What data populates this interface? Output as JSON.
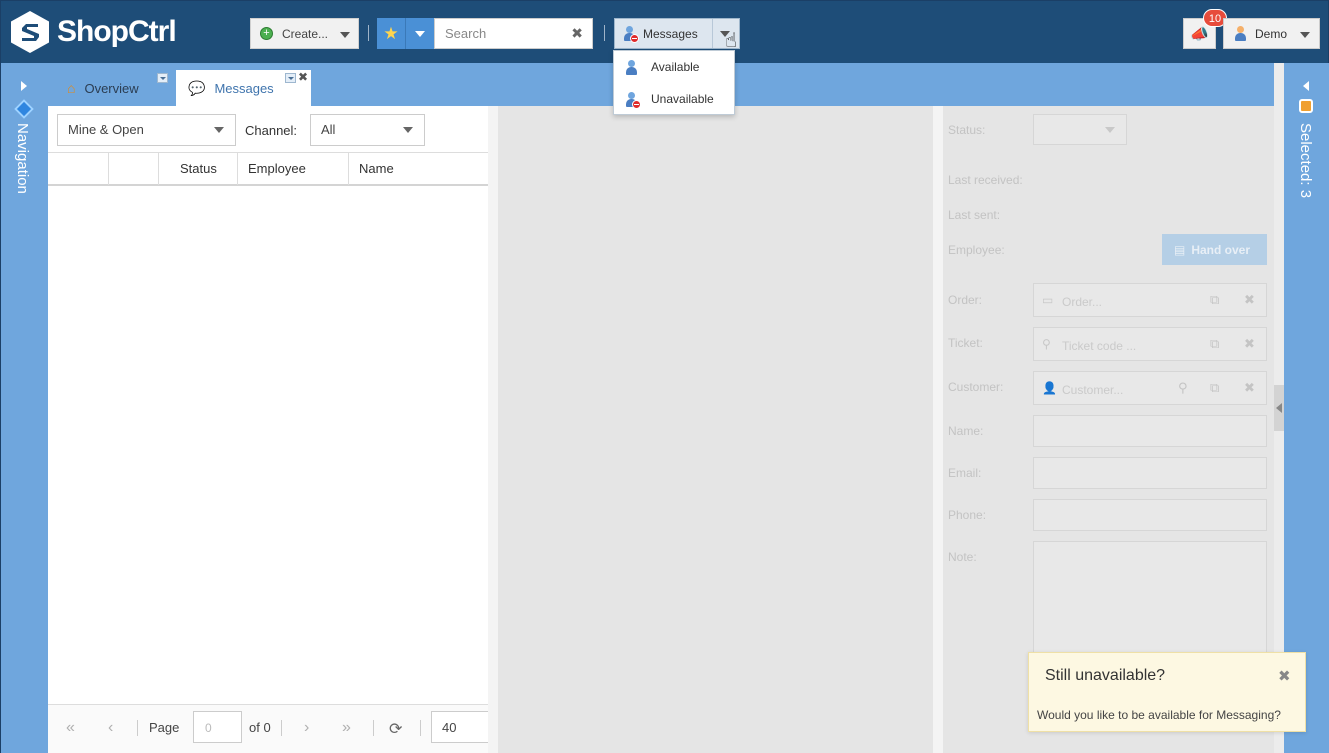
{
  "app": {
    "name": "ShopCtrl"
  },
  "header": {
    "create_label": "Create...",
    "search_placeholder": "Search",
    "messages_label": "Messages",
    "notification_count": "10",
    "user_label": "Demo"
  },
  "status_menu": {
    "items": [
      {
        "label": "Available",
        "icon": "person-available-icon"
      },
      {
        "label": "Unavailable",
        "icon": "person-unavailable-icon"
      }
    ]
  },
  "rails": {
    "left_label": "Navigation",
    "right_label": "Selected: 3"
  },
  "tabs": [
    {
      "label": "Overview",
      "icon": "home-icon"
    },
    {
      "label": "Messages",
      "icon": "speech-bubbles-icon",
      "active": true
    }
  ],
  "list": {
    "filter_value": "Mine & Open",
    "channel_label": "Channel:",
    "channel_value": "All",
    "columns": [
      "",
      "",
      "Status",
      "Employee",
      "Name"
    ],
    "rows": []
  },
  "pager": {
    "page_label": "Page",
    "page_value": "0",
    "of_label": "of 0",
    "page_size": "40"
  },
  "detail": {
    "status_label": "Status:",
    "last_received_label": "Last received:",
    "last_sent_label": "Last sent:",
    "employee_label": "Employee:",
    "handover_label": "Hand over",
    "order_label": "Order:",
    "order_placeholder": "Order...",
    "ticket_label": "Ticket:",
    "ticket_placeholder": "Ticket code ...",
    "customer_label": "Customer:",
    "customer_placeholder": "Customer...",
    "name_label": "Name:",
    "email_label": "Email:",
    "phone_label": "Phone:",
    "note_label": "Note:"
  },
  "toast": {
    "title": "Still unavailable?",
    "message": "Would you like to be available for Messaging?"
  },
  "colors": {
    "topbar": "#1e4d78",
    "accent": "#6fa6dd",
    "button_blue": "#4a90d6",
    "badge": "#e74c3c",
    "toast_bg": "#fdf8e2"
  }
}
